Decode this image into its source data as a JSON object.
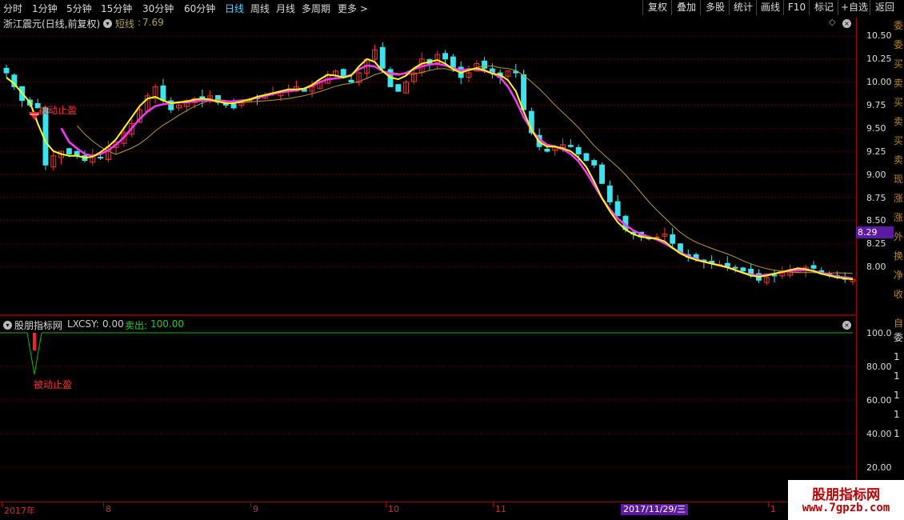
{
  "toolbar": {
    "timeframes": [
      "分时",
      "1分钟",
      "5分钟",
      "15分钟",
      "30分钟",
      "60分钟",
      "日线",
      "周线",
      "月线",
      "多周期",
      "更多"
    ],
    "active_timeframe": "日线",
    "more_arrow": ">",
    "buttons": [
      "复权",
      "叠加",
      "多股",
      "统计",
      "画线",
      "F10",
      "标记",
      "+自选",
      "返回"
    ]
  },
  "main_chart": {
    "stock_title": "浙江震元(日线,前复权)",
    "indicator_label": "短线",
    "indicator_value": "7.69",
    "diamond": "◇",
    "current_price_tag": "8.29",
    "signal_label": "被动止盈",
    "y_axis_ticks": [
      "10.50",
      "10.25",
      "10.00",
      "9.75",
      "9.50",
      "9.25",
      "9.00",
      "8.75",
      "8.50",
      "8.25",
      "8.00"
    ]
  },
  "indicator_panel": {
    "title": "股朋指标网",
    "lxcsy_label": "LXCSY:",
    "lxcsy_value": "0.00",
    "sell_label": "卖出:",
    "sell_value": "100.00",
    "signal_label": "被动止盈",
    "y_axis_ticks": [
      "100.0",
      "80.00",
      "60.00",
      "40.00",
      "20.00"
    ]
  },
  "date_axis": {
    "labels": [
      "2017年",
      "8",
      "9",
      "10",
      "11",
      "1"
    ],
    "cursor_date": "2017/11/29/三"
  },
  "right_strip_chars": [
    "委",
    "委",
    "买",
    "卖",
    "买",
    "卖",
    "买",
    "卖",
    "现",
    "涨",
    "涨",
    "外",
    "换",
    "净",
    "收"
  ],
  "right_strip_lower": [
    "自",
    "委",
    "1",
    "1",
    "1",
    "1",
    "1"
  ],
  "watermark": {
    "title": "股朋指标网",
    "url": "www.7gpzb.com"
  },
  "colors": {
    "up_candle": "#ff3030",
    "down_candle": "#33e8f0",
    "ma_short": "#ffff00",
    "ma_long": "#ff33ff",
    "ma_slow": "#b89a2a",
    "sell_line": "#00c000",
    "grid": "#700000",
    "active_tab": "#4fd6ff"
  },
  "chart_data": {
    "type": "candlestick",
    "ylim": [
      7.9,
      10.6
    ],
    "closes": [
      10.1,
      9.95,
      9.8,
      9.75,
      9.72,
      9.1,
      9.2,
      9.25,
      9.22,
      9.2,
      9.15,
      9.2,
      9.18,
      9.3,
      9.35,
      9.45,
      9.55,
      9.7,
      9.85,
      9.95,
      9.8,
      9.7,
      9.75,
      9.8,
      9.82,
      9.8,
      9.85,
      9.78,
      9.75,
      9.72,
      9.78,
      9.8,
      9.82,
      9.85,
      9.88,
      9.9,
      9.92,
      9.95,
      9.9,
      9.95,
      10.0,
      10.08,
      10.12,
      10.05,
      10.0,
      10.1,
      10.25,
      10.35,
      10.15,
      9.95,
      9.9,
      10.0,
      10.1,
      10.25,
      10.2,
      10.3,
      10.25,
      10.15,
      10.05,
      10.1,
      10.2,
      10.15,
      10.1,
      10.05,
      10.12,
      10.1,
      9.7,
      9.45,
      9.3,
      9.25,
      9.3,
      9.32,
      9.3,
      9.22,
      9.15,
      9.1,
      8.9,
      8.7,
      8.55,
      8.4,
      8.35,
      8.32,
      8.3,
      8.32,
      8.35,
      8.25,
      8.15,
      8.1,
      8.08,
      8.05,
      8.03,
      8.02,
      8.0,
      7.98,
      7.95,
      7.92,
      7.85,
      7.88,
      7.9,
      7.93,
      7.95,
      7.97,
      7.99,
      7.98,
      7.92,
      7.9,
      7.88,
      7.86,
      7.86
    ],
    "ma_short": [
      10.05,
      9.98,
      9.88,
      9.78,
      9.55,
      9.35,
      9.25,
      9.22,
      9.2,
      9.2,
      9.18,
      9.19,
      9.24,
      9.3,
      9.38,
      9.5,
      9.62,
      9.74,
      9.82,
      9.84,
      9.8,
      9.77,
      9.78,
      9.79,
      9.81,
      9.82,
      9.81,
      9.79,
      9.77,
      9.77,
      9.79,
      9.81,
      9.84,
      9.86,
      9.88,
      9.9,
      9.92,
      9.92,
      9.93,
      9.97,
      10.03,
      10.08,
      10.07,
      10.05,
      10.07,
      10.17,
      10.25,
      10.22,
      10.12,
      10.05,
      10.03,
      10.07,
      10.15,
      10.2,
      10.22,
      10.24,
      10.2,
      10.14,
      10.1,
      10.13,
      10.15,
      10.13,
      10.09,
      10.08,
      10.02,
      9.9,
      9.68,
      9.48,
      9.35,
      9.3,
      9.3,
      9.28,
      9.25,
      9.18,
      9.08,
      8.92,
      8.74,
      8.6,
      8.48,
      8.4,
      8.35,
      8.32,
      8.31,
      8.3,
      8.27,
      8.2,
      8.14,
      8.1,
      8.07,
      8.05,
      8.03,
      8.01,
      7.99,
      7.96,
      7.93,
      7.9,
      7.89,
      7.9,
      7.92,
      7.94,
      7.96,
      7.98,
      7.97,
      7.95,
      7.92,
      7.9,
      7.88,
      7.87,
      7.86
    ],
    "ma_long": [
      null,
      null,
      null,
      null,
      null,
      null,
      null,
      9.5,
      9.35,
      9.28,
      9.22,
      9.2,
      9.22,
      9.26,
      9.32,
      9.4,
      9.5,
      9.6,
      9.68,
      9.74,
      9.76,
      9.77,
      9.78,
      9.78,
      9.79,
      9.8,
      9.8,
      9.79,
      9.79,
      9.79,
      9.8,
      9.81,
      9.83,
      9.85,
      9.87,
      9.89,
      9.9,
      9.91,
      9.93,
      9.96,
      10.0,
      10.03,
      10.04,
      10.05,
      10.08,
      10.14,
      10.18,
      10.17,
      10.12,
      10.09,
      10.08,
      10.1,
      10.14,
      10.17,
      10.19,
      10.2,
      10.18,
      10.15,
      10.13,
      10.14,
      10.14,
      10.12,
      10.1,
      10.05,
      9.95,
      9.8,
      9.62,
      9.48,
      9.38,
      9.32,
      9.3,
      9.27,
      9.22,
      9.14,
      9.02,
      8.88,
      8.74,
      8.62,
      8.52,
      8.45,
      8.39,
      8.35,
      8.32,
      8.29,
      8.25,
      8.2,
      8.15,
      8.11,
      8.08,
      8.05,
      8.03,
      8.01,
      7.99,
      7.96,
      7.93,
      7.91,
      7.9,
      7.91,
      7.92,
      7.94,
      7.95,
      7.96,
      7.96,
      7.95,
      7.93,
      7.91,
      7.89,
      7.88,
      7.87
    ],
    "indicator": {
      "ylim": [
        0,
        105
      ],
      "sell_value": 100,
      "lxcsy_value": 0
    }
  }
}
